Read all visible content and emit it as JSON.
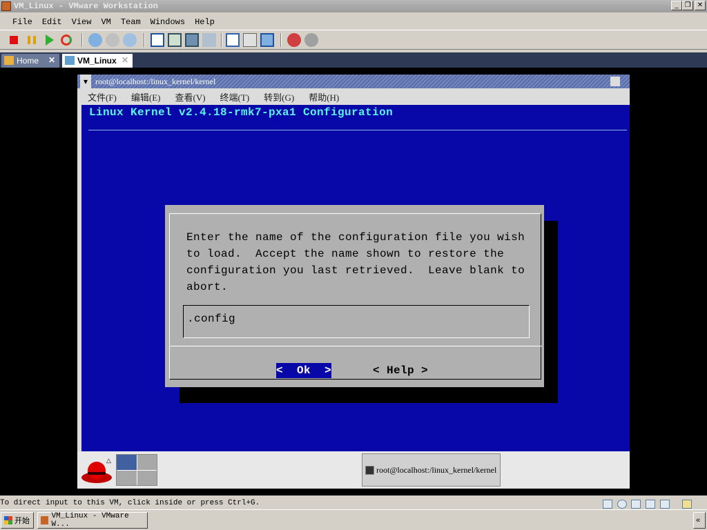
{
  "window": {
    "title": "VM_Linux - VMware Workstation"
  },
  "menu": [
    "File",
    "Edit",
    "View",
    "VM",
    "Team",
    "Windows",
    "Help"
  ],
  "tabs": [
    {
      "label": "Home"
    },
    {
      "label": "VM_Linux"
    }
  ],
  "guest": {
    "window_title": "root@localhost:/linux_kernel/kernel",
    "menu": [
      "文件(F)",
      "编辑(E)",
      "查看(V)",
      "终端(T)",
      "转到(G)",
      "帮助(H)"
    ],
    "config_title": "Linux Kernel v2.4.18-rmk7-pxa1 Configuration",
    "dialog": {
      "message": "Enter the name of the configuration file you wish\nto load.  Accept the name shown to restore the\nconfiguration you last retrieved.  Leave blank to\nabort.",
      "field_value": ".config",
      "ok_label": "<  Ok  >",
      "help_label": "< Help >"
    },
    "panel_task": "root@localhost:/linux_kernel/kernel"
  },
  "status": {
    "text": "To direct input to this VM, click inside or press Ctrl+G."
  },
  "taskbar": {
    "start": "开始",
    "task": "VM_Linux - VMware W...",
    "collapse": "«"
  },
  "colors": {
    "terminal_bg": "#0808a8",
    "title_cyan": "#5cf4f4",
    "dialog_bg": "#b0b0b0"
  }
}
